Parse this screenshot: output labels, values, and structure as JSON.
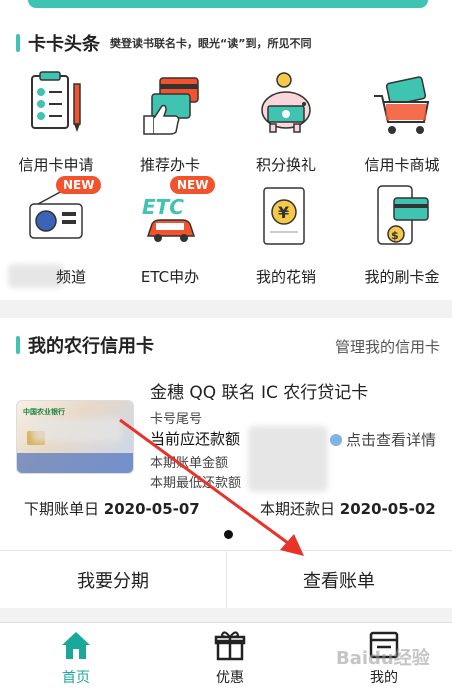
{
  "news": {
    "title": "卡卡头条",
    "subtitle": "樊登读书联名卡，眼光“读”到，所见不同"
  },
  "tiles": [
    {
      "label": "信用卡申请",
      "icon": "clipboard-checklist-icon"
    },
    {
      "label": "推荐办卡",
      "icon": "thumbs-up-card-icon"
    },
    {
      "label": "积分换礼",
      "icon": "piggy-bank-icon"
    },
    {
      "label": "信用卡商城",
      "icon": "shopping-cart-icon"
    },
    {
      "label": "频道",
      "icon": "radio-icon",
      "badge": "NEW"
    },
    {
      "label": "ETC申办",
      "icon": "etc-car-icon",
      "badge": "NEW"
    },
    {
      "label": "我的花销",
      "icon": "yen-bill-icon"
    },
    {
      "label": "我的刷卡金",
      "icon": "phone-card-icon"
    }
  ],
  "credit": {
    "title": "我的农行信用卡",
    "manage": "管理我的信用卡",
    "card_name": "金穗 QQ 联名 IC 农行贷记卡",
    "card_tail_label": "卡号尾号",
    "due_label": "当前应还款额",
    "detail_link": "点击查看详情",
    "bill_amount_label": "本期账单金额",
    "min_due_label": "本期最低还款额",
    "next_bill_label": "下期账单日",
    "next_bill_date": "2020-05-07",
    "repay_label": "本期还款日",
    "repay_date": "2020-05-02",
    "card_bank_text": "中国农业银行",
    "installment_button": "我要分期",
    "view_bill_button": "查看账单"
  },
  "tabbar": {
    "home": "首页",
    "offers": "优惠",
    "mine": "我的"
  },
  "colors": {
    "accent": "#3ec4b0",
    "home_active": "#1aa89a",
    "badge": "#f2532d",
    "annotation_arrow": "#e8322a"
  },
  "watermark": "Baidu经验"
}
